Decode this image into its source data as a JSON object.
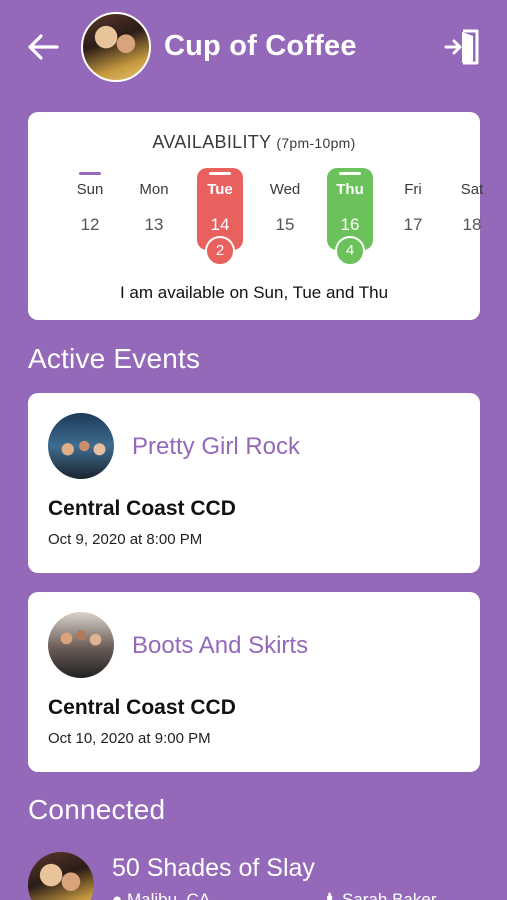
{
  "header": {
    "title": "Cup of Coffee",
    "back_icon": "arrow-left-icon",
    "exit_icon": "exit-door-icon"
  },
  "availability": {
    "title": "AVAILABILITY",
    "subtitle": "(7pm-10pm)",
    "days": [
      {
        "name": "Sun",
        "number": "12",
        "selected": false,
        "marked": true,
        "count": ""
      },
      {
        "name": "Mon",
        "number": "13",
        "selected": false,
        "marked": false,
        "count": ""
      },
      {
        "name": "Tue",
        "number": "14",
        "selected": true,
        "marked": true,
        "count": "2",
        "color": "#e8615e"
      },
      {
        "name": "Wed",
        "number": "15",
        "selected": false,
        "marked": false,
        "count": ""
      },
      {
        "name": "Thu",
        "number": "16",
        "selected": true,
        "marked": true,
        "count": "4",
        "color": "#6cc25a"
      },
      {
        "name": "Fri",
        "number": "17",
        "selected": false,
        "marked": false,
        "count": ""
      },
      {
        "name": "Sat",
        "number": "18",
        "selected": false,
        "marked": false,
        "count": ""
      }
    ],
    "summary": "I am available on Sun, Tue and Thu"
  },
  "active_events": {
    "title": "Active Events",
    "events": [
      {
        "name": "Pretty Girl Rock",
        "venue": "Central Coast CCD",
        "date": "Oct 9, 2020 at 8:00 PM"
      },
      {
        "name": "Boots And Skirts",
        "venue": "Central Coast CCD",
        "date": "Oct 10, 2020 at 9:00 PM"
      }
    ]
  },
  "connected": {
    "title": "Connected",
    "items": [
      {
        "name": "50 Shades of Slay",
        "location": "Malibu, CA",
        "members": "Sarah Baker"
      }
    ]
  },
  "colors": {
    "background": "#9469b9",
    "accent_text": "#9469b9",
    "tue_highlight": "#e8615e",
    "thu_highlight": "#6cc25a"
  }
}
